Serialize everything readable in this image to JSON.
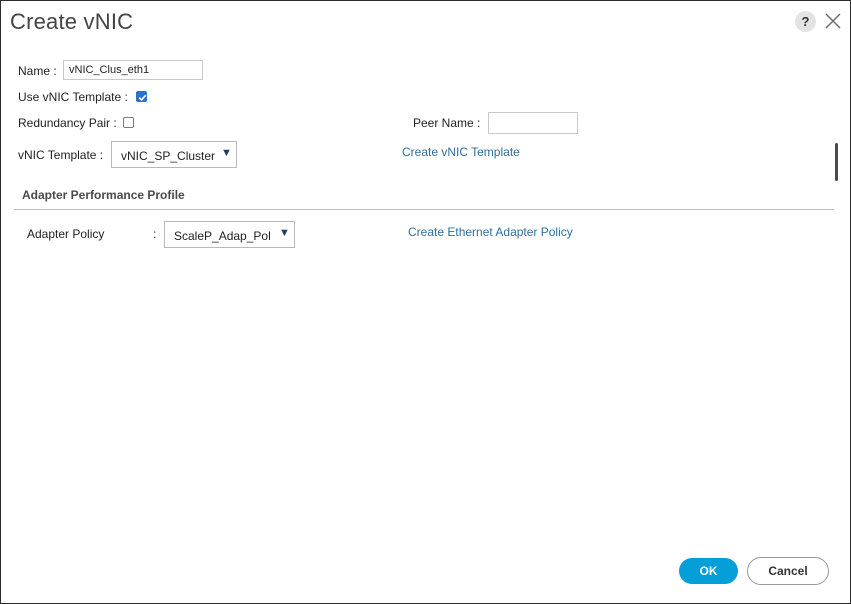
{
  "dialog": {
    "title": "Create vNIC",
    "help_label": "?"
  },
  "form": {
    "name_label": "Name :",
    "name_value": "vNIC_Clus_eth1",
    "use_template_label": "Use vNIC Template :",
    "use_template_checked": true,
    "redundancy_label": "Redundancy Pair :",
    "redundancy_checked": false,
    "peer_name_label": "Peer Name :",
    "peer_name_value": "",
    "template_label": "vNIC Template :",
    "template_selected": "vNIC_SP_Cluster",
    "create_template_link": "Create vNIC Template"
  },
  "adapter": {
    "section_title": "Adapter Performance Profile",
    "policy_label": "Adapter Policy",
    "policy_colon": ":",
    "policy_selected": "ScaleP_Adap_Pol",
    "create_policy_link": "Create Ethernet Adapter Policy"
  },
  "footer": {
    "ok_label": "OK",
    "cancel_label": "Cancel"
  },
  "icons": {
    "dropdown": "caret-down-icon",
    "close": "close-x-icon",
    "check": "checkmark-icon"
  },
  "colors": {
    "primary_button": "#049fd9",
    "link": "#2d6f9e",
    "checkbox_checked": "#2a73c9"
  }
}
